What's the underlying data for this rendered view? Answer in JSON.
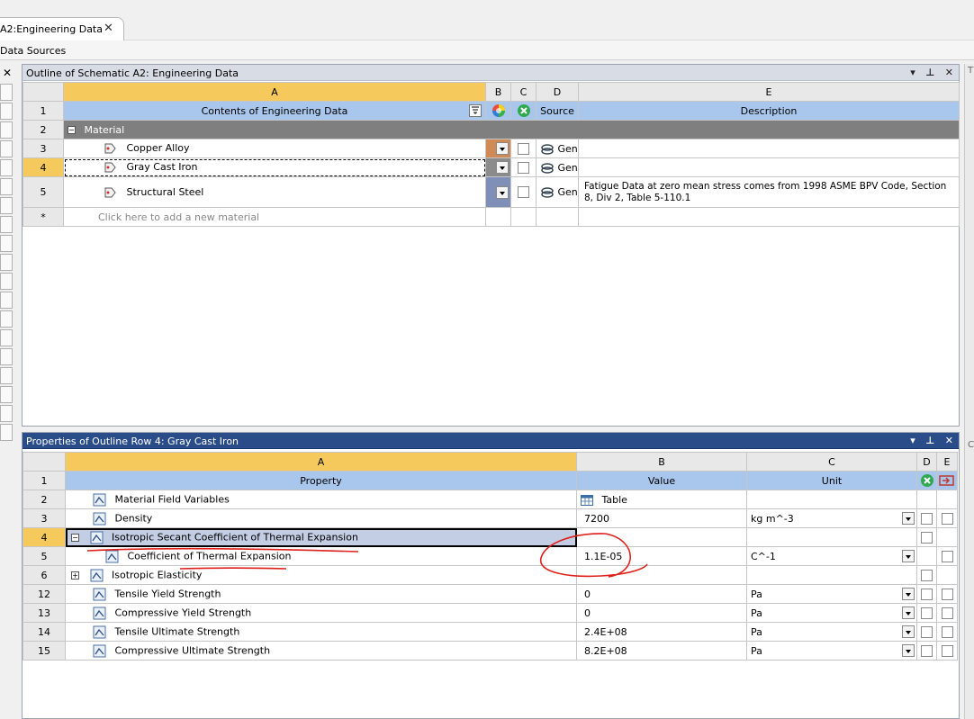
{
  "tab": {
    "title": "A2:Engineering Data",
    "close": "✕"
  },
  "toolbar": {
    "data_sources": "Data Sources"
  },
  "left_strip": {
    "close": "✕"
  },
  "right_strip": {
    "top": "T",
    "mid": "C"
  },
  "outline": {
    "title": "Outline of Schematic A2: Engineering Data",
    "controls": [
      "▾",
      "⊥",
      "✕"
    ],
    "col_letters": [
      "A",
      "B",
      "C",
      "D",
      "E"
    ],
    "header": {
      "row": "1",
      "contents": "Contents of Engineering Data",
      "source": "Source",
      "description": "Description"
    },
    "category": {
      "row": "2",
      "label": "Material"
    },
    "rows": [
      {
        "row": "3",
        "name": "Copper Alloy",
        "source": "Gen",
        "description": ""
      },
      {
        "row": "4",
        "name": "Gray Cast Iron",
        "source": "Gen",
        "description": ""
      },
      {
        "row": "5",
        "name": "Structural Steel",
        "source": "Gen",
        "description": "Fatigue Data at zero mean stress comes from 1998 ASME BPV Code, Section 8, Div 2, Table 5-110.1"
      }
    ],
    "add_row": {
      "row": "*",
      "placeholder": "Click here to add a new material"
    }
  },
  "properties": {
    "title": "Properties of Outline Row 4: Gray Cast Iron",
    "controls": [
      "▾",
      "⊥",
      "✕"
    ],
    "col_letters": [
      "A",
      "B",
      "C",
      "D",
      "E"
    ],
    "header": {
      "row": "1",
      "property": "Property",
      "value": "Value",
      "unit": "Unit"
    },
    "rows": [
      {
        "row": "2",
        "name": "Material Field Variables",
        "value": "Table",
        "unit": ""
      },
      {
        "row": "3",
        "name": "Density",
        "value": "7200",
        "unit": "kg m^-3"
      },
      {
        "row": "4",
        "name": "Isotropic Secant Coefficient of Thermal Expansion",
        "value": "",
        "unit": ""
      },
      {
        "row": "5",
        "name": "Coefficient of Thermal Expansion",
        "value": "1.1E-05",
        "unit": "C^-1"
      },
      {
        "row": "6",
        "name": "Isotropic Elasticity",
        "value": "",
        "unit": ""
      },
      {
        "row": "12",
        "name": "Tensile Yield Strength",
        "value": "0",
        "unit": "Pa"
      },
      {
        "row": "13",
        "name": "Compressive Yield Strength",
        "value": "0",
        "unit": "Pa"
      },
      {
        "row": "14",
        "name": "Tensile Ultimate Strength",
        "value": "2.4E+08",
        "unit": "Pa"
      },
      {
        "row": "15",
        "name": "Compressive Ultimate Strength",
        "value": "8.2E+08",
        "unit": "Pa"
      }
    ]
  },
  "colors": {
    "selection": "#f5c95c",
    "header_blue": "#a9c6ec",
    "category_gray": "#7f7f7f",
    "annotation_red": "#e0201b"
  }
}
